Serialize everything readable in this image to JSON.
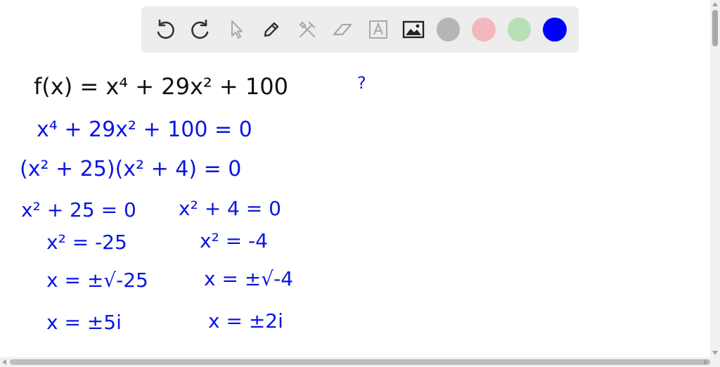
{
  "toolbar": {
    "tools": [
      {
        "name": "undo-icon"
      },
      {
        "name": "redo-icon"
      },
      {
        "name": "pointer-icon"
      },
      {
        "name": "pencil-icon"
      },
      {
        "name": "tools-icon"
      },
      {
        "name": "eraser-icon"
      },
      {
        "name": "text-icon"
      },
      {
        "name": "image-icon"
      }
    ],
    "colors": [
      "#b5b5b5",
      "#f2b8bd",
      "#b7e0b6",
      "#0000ff"
    ],
    "selected_color": "#0000ff"
  },
  "whiteboard": {
    "lines": [
      {
        "id": "line1",
        "text": "f(x) = x⁴ + 29x² + 100",
        "color": "#111111"
      },
      {
        "id": "note",
        "text": "?",
        "color": "#0a16e0"
      },
      {
        "id": "line2",
        "text": "x⁴ + 29x² + 100 = 0",
        "color": "#0a16e0"
      },
      {
        "id": "line3",
        "text": "(x² + 25)(x² + 4) = 0",
        "color": "#0a16e0"
      },
      {
        "id": "line4a",
        "text": "x² + 25 = 0",
        "color": "#0a16e0"
      },
      {
        "id": "line4b",
        "text": "x² + 4 = 0",
        "color": "#0a16e0"
      },
      {
        "id": "line5a",
        "text": "x² = -25",
        "color": "#0a16e0"
      },
      {
        "id": "line5b",
        "text": "x² = -4",
        "color": "#0a16e0"
      },
      {
        "id": "line6a",
        "text": "x = ±√-25",
        "color": "#0a16e0"
      },
      {
        "id": "line6b",
        "text": "x = ±√-4",
        "color": "#0a16e0"
      },
      {
        "id": "line7a",
        "text": "x = ±5i",
        "color": "#0a16e0"
      },
      {
        "id": "line7b",
        "text": "x = ±2i",
        "color": "#0a16e0"
      }
    ]
  }
}
